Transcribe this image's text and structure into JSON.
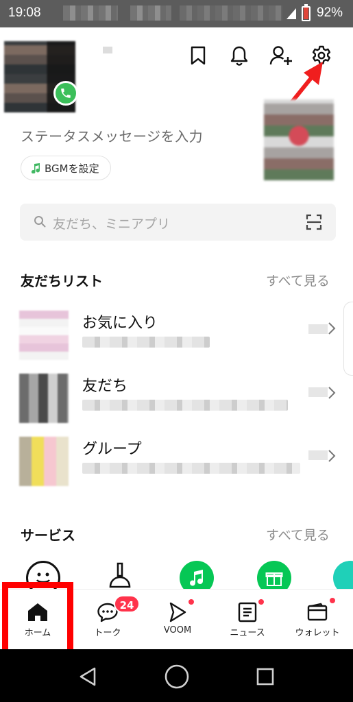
{
  "status_bar": {
    "time": "19:08",
    "battery_percent": "92%"
  },
  "profile": {
    "status_message_placeholder": "ステータスメッセージを入力",
    "bgm_label": "BGMを設定"
  },
  "header_icons": [
    "bookmark-icon",
    "bell-icon",
    "add-friend-icon",
    "settings-gear-icon"
  ],
  "search": {
    "placeholder": "友だち、ミニアプリ"
  },
  "friends_section": {
    "title": "友だちリスト",
    "see_all": "すべて見る",
    "items": [
      {
        "label": "お気に入り"
      },
      {
        "label": "友だち"
      },
      {
        "label": "グループ"
      }
    ]
  },
  "services_section": {
    "title": "サービス",
    "see_all": "すべて見る"
  },
  "bottom_nav": {
    "items": [
      {
        "label": "ホーム",
        "icon": "home-icon",
        "active": true
      },
      {
        "label": "トーク",
        "icon": "chat-bubble-icon",
        "badge": "24"
      },
      {
        "label": "VOOM",
        "icon": "voom-play-icon"
      },
      {
        "label": "ニュース",
        "icon": "news-icon"
      },
      {
        "label": "ウォレット",
        "icon": "wallet-icon"
      }
    ]
  },
  "colors": {
    "line_green": "#06c755",
    "badge_red": "#ff334b",
    "annotation_red": "#ff0000"
  }
}
